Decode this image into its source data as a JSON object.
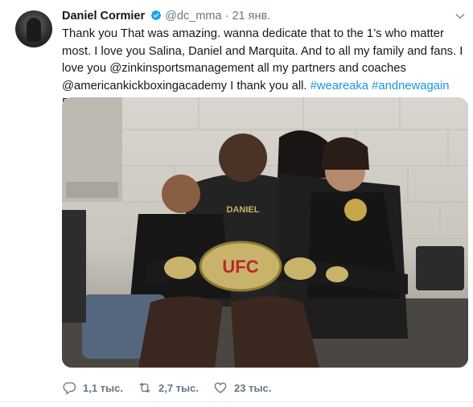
{
  "tweet": {
    "author_name": "Daniel Cormier",
    "handle": "@dc_mma",
    "separator": "·",
    "date": "21 янв.",
    "text_main": "Thank you That was amazing. wanna dedicate that to the 1’s who matter most. I love you Salina, Daniel and Marquita. And to all my family and fans. I love you @zinkinsportsmanagement all my partners and coaches @americankickboxingacademy I thank you all. ",
    "hashtag_1": "#weareaka",
    "hashtag_2": "#andnewagain",
    "text_end": " DC",
    "photo_label": "UFC",
    "shirt_text": "DANIEL"
  },
  "actions": {
    "replies": "1,1 тыс.",
    "retweets": "2,7 тыс.",
    "likes": "23 тыс."
  },
  "colors": {
    "link": "#1b95e0",
    "muted": "#657786",
    "verified": "#1da1f2"
  },
  "icons": [
    "verified-icon",
    "chevron-down-icon",
    "reply-icon",
    "retweet-icon",
    "like-icon"
  ]
}
